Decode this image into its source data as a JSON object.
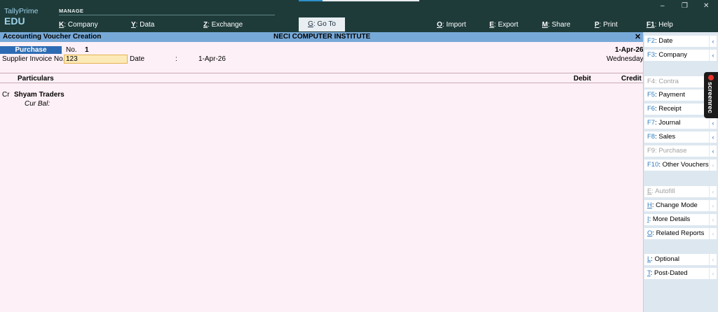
{
  "brand": {
    "name": "TallyPrime",
    "edition": "EDU"
  },
  "topbar": {
    "section_label": "MANAGE",
    "menu": [
      {
        "key": "K",
        "label": ": Company"
      },
      {
        "key": "Y",
        "label": ": Data"
      },
      {
        "key": "Z",
        "label": ": Exchange"
      },
      {
        "key": "G",
        "label": ": Go To"
      },
      {
        "key": "O",
        "label": ": Import"
      },
      {
        "key": "E",
        "label": ": Export"
      },
      {
        "key": "M",
        "label": ": Share"
      },
      {
        "key": "P",
        "label": ": Print"
      },
      {
        "key": "F1",
        "label": ": Help"
      }
    ],
    "window_controls": [
      "–",
      "❐",
      "✕"
    ]
  },
  "titlebar": {
    "title": "Accounting Voucher Creation",
    "company": "NECI COMPUTER INSTITUTE",
    "close": "✕"
  },
  "voucher": {
    "type": "Purchase",
    "no_label": "No.",
    "no_value": "1",
    "date_top": "1-Apr-26",
    "day": "Wednesday",
    "supplier_invoice_label": "Supplier Invoice No. :",
    "supplier_invoice_value": "123",
    "date_label": "Date",
    "date_colon": ":",
    "date_value": "1-Apr-26"
  },
  "table": {
    "headers": {
      "particulars": "Particulars",
      "debit": "Debit",
      "credit": "Credit"
    },
    "rows": [
      {
        "dr_cr": "Cr",
        "ledger": "Shyam Traders",
        "cur_bal_label": "Cur Bal:"
      }
    ]
  },
  "right_panel": {
    "buttons": [
      {
        "key": "F2",
        "label": ": Date",
        "enabled": true
      },
      {
        "key": "F3",
        "label": ": Company",
        "enabled": true
      },
      {
        "key": "F4",
        "label": ": Contra",
        "enabled": false
      },
      {
        "key": "F5",
        "label": ": Payment",
        "enabled": true
      },
      {
        "key": "F6",
        "label": ": Receipt",
        "enabled": true
      },
      {
        "key": "F7",
        "label": ": Journal",
        "enabled": true
      },
      {
        "key": "F8",
        "label": ": Sales",
        "enabled": true
      },
      {
        "key": "F9",
        "label": ": Purchase",
        "enabled": false
      },
      {
        "key": "F10",
        "label": ": Other Vouchers",
        "enabled": true
      },
      {
        "key": "E",
        "label": ": Autofill",
        "enabled": false
      },
      {
        "key": "H",
        "label": ": Change Mode",
        "enabled": true
      },
      {
        "key": "I",
        "label": ": More Details",
        "enabled": true
      },
      {
        "key": "O",
        "label": ": Related Reports",
        "enabled": true
      },
      {
        "key": "L",
        "label": ": Optional",
        "enabled": true
      },
      {
        "key": "T",
        "label": ": Post-Dated",
        "enabled": true
      }
    ],
    "arrow": "‹"
  },
  "overlay": {
    "screenrec_label": "screenrec"
  },
  "colors": {
    "topbar": "#1e3b3a",
    "titlebar": "#77a9d8",
    "voucher_type_bg": "#2d6cb4",
    "body_bg": "#fdf0f6",
    "panel_bg": "#dde7f0",
    "key_blue": "#2d7cc1"
  }
}
